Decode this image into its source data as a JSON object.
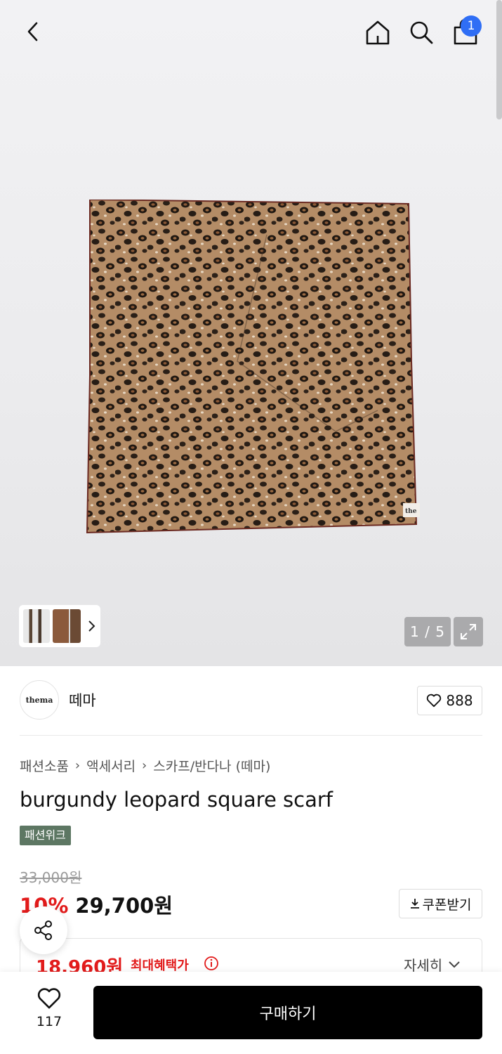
{
  "header": {
    "icons": [
      "back-arrow-icon",
      "home-icon",
      "search-icon",
      "shopping-bag-icon"
    ],
    "cart_badge": "1"
  },
  "gallery": {
    "counter": "1 / 5",
    "thumb_watermark": "the"
  },
  "seller": {
    "logo_text": "thema",
    "name": "떼마",
    "like_count": "888"
  },
  "breadcrumb": [
    "패션소품",
    "액세서리",
    "스카프/반다나 (떼마)"
  ],
  "product": {
    "title": "burgundy leopard square scarf",
    "tag": "패션위크",
    "original_price": "33,000원",
    "discount": "10%",
    "price": "29,700원",
    "coupon_label": "쿠폰받기"
  },
  "benefit": {
    "price": "18,960원",
    "label": "최대혜택가",
    "detail_label": "자세히"
  },
  "bottom_bar": {
    "wish_count": "117",
    "buy_label": "구매하기"
  },
  "colors": {
    "accent_red": "#e21b1b",
    "badge_blue": "#2f6ef5",
    "tag_green": "#5d7763",
    "buy_button": "#000000"
  }
}
